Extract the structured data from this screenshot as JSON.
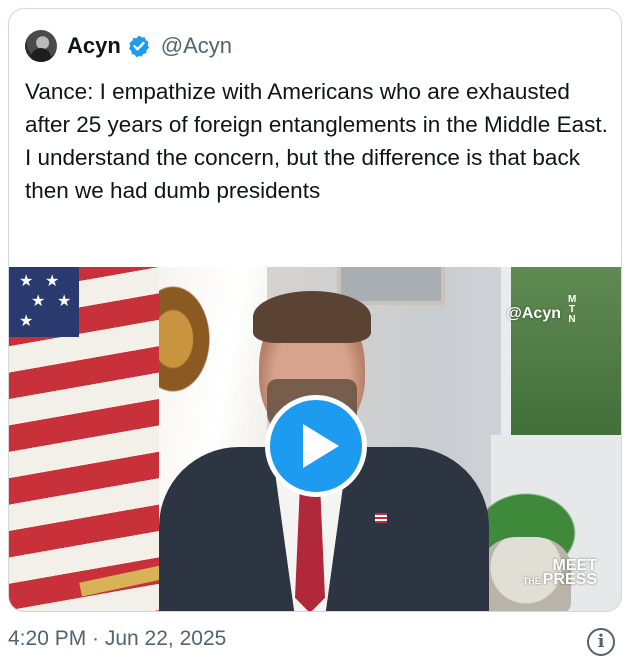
{
  "tweet": {
    "author_name": "Acyn",
    "author_handle": "@Acyn",
    "verified": true,
    "text": "Vance: I empathize with Americans who are exhausted after 25 years of foreign entanglements in the Middle East. I understand the concern, but the difference is that back then we had dumb presidents",
    "timestamp": "4:20 PM · Jun 22, 2025"
  },
  "media": {
    "type": "video",
    "watermark": "@Acyn",
    "network_mark": "MTN",
    "show_logo_top": "MEET",
    "show_logo_small": "THE",
    "show_logo_bottom": "PRESS",
    "play_icon": "play-icon"
  },
  "icons": {
    "verified": "verified-badge-icon",
    "info": "info-icon"
  },
  "colors": {
    "accent": "#1d9bf0",
    "text": "#0f1419",
    "secondary_text": "#536471",
    "border": "#cfd9de"
  }
}
